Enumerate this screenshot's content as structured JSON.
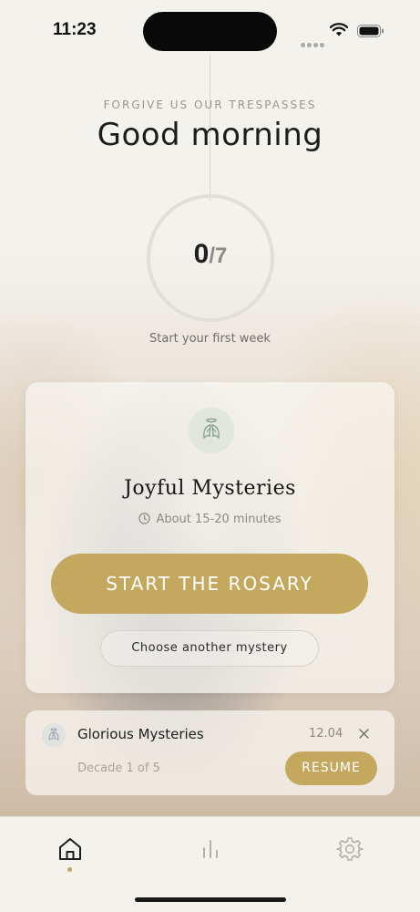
{
  "status_bar": {
    "time": "11:23",
    "icons": [
      "signal-dots-icon",
      "wifi-icon",
      "battery-icon"
    ]
  },
  "header": {
    "subtitle": "FORGIVE US OUR TRESPASSES",
    "greeting": "Good morning"
  },
  "progress": {
    "completed": "0",
    "total_label": "/7",
    "completed_value": 0,
    "total_value": 7,
    "caption": "Start your first week"
  },
  "main_card": {
    "icon": "angel-icon",
    "title": "Joyful Mysteries",
    "duration": "About 15-20 minutes",
    "start_button": "START THE ROSARY",
    "choose_button": "Choose another mystery"
  },
  "resume_card": {
    "icon": "angel-icon",
    "title": "Glorious Mysteries",
    "date": "12.04",
    "progress": "Decade 1 of 5",
    "resume_button": "RESUME"
  },
  "tab_bar": {
    "tabs": [
      {
        "icon": "home-icon",
        "active": true
      },
      {
        "icon": "stats-icon",
        "active": false
      },
      {
        "icon": "settings-icon",
        "active": false
      }
    ]
  },
  "colors": {
    "accent": "#c3a85e",
    "background": "#f4f2ed",
    "text": "#1c1c1c",
    "muted": "#8c8983"
  }
}
